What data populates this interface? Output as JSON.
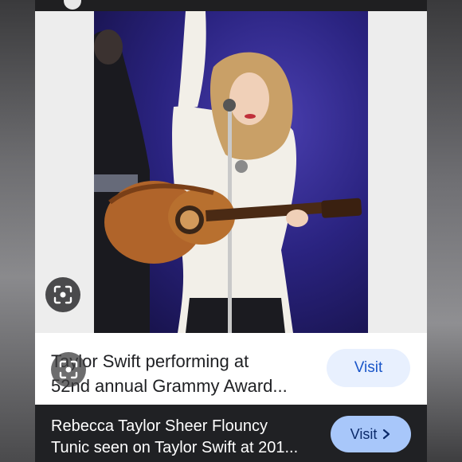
{
  "result_card": {
    "caption_line1": "Taylor Swift performing at",
    "caption_line2": "52nd annual Grammy Award...",
    "visit_label": "Visit",
    "image_alt_icon": "lens-search-icon"
  },
  "bottom_result": {
    "line1": "Rebecca Taylor Sheer Flouncy",
    "line2": "Tunic seen on Taylor Swift at 201...",
    "visit_label": "Visit",
    "visit_icon": "chevron-right-icon"
  },
  "colors": {
    "card_bg": "#ffffff",
    "visit_bg": "#e8f0fe",
    "visit_text": "#1a56c9",
    "bottom_bg": "#202124",
    "bottom_visit_bg": "#a8c7fa"
  }
}
